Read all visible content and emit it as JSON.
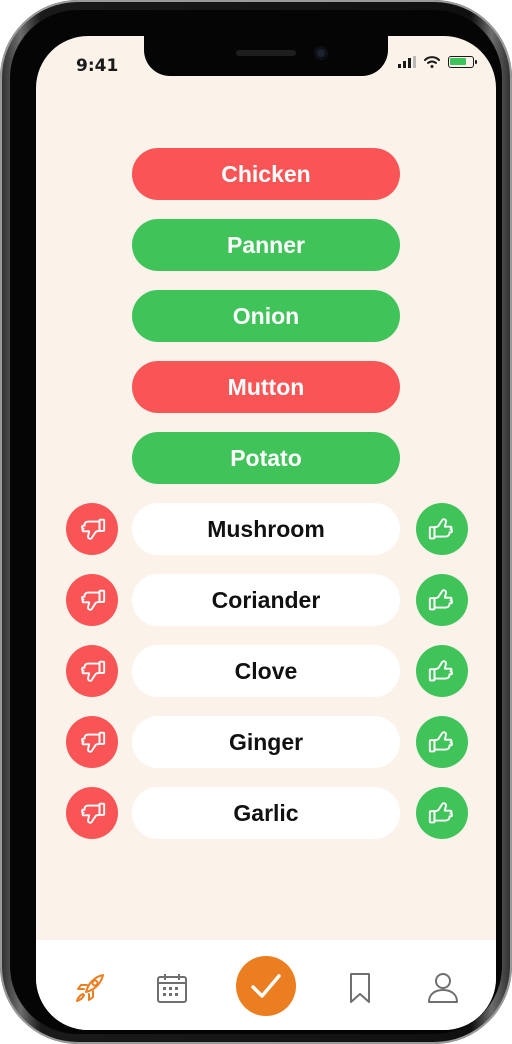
{
  "status_bar": {
    "time": "9:41",
    "battery_level": 0.8
  },
  "selected_ingredients": [
    {
      "label": "Chicken",
      "state": "disliked",
      "color": "#fa5556"
    },
    {
      "label": "Panner",
      "state": "liked",
      "color": "#40c45a"
    },
    {
      "label": "Onion",
      "state": "liked",
      "color": "#40c45a"
    },
    {
      "label": "Mutton",
      "state": "disliked",
      "color": "#fa5556"
    },
    {
      "label": "Potato",
      "state": "liked",
      "color": "#40c45a"
    }
  ],
  "pending_ingredients": [
    {
      "label": "Mushroom"
    },
    {
      "label": "Coriander"
    },
    {
      "label": "Clove"
    },
    {
      "label": "Ginger"
    },
    {
      "label": "Garlic"
    }
  ],
  "actions": {
    "dislike_icon": "thumbs-down-icon",
    "like_icon": "thumbs-up-icon",
    "dislike_color": "#fa5556",
    "like_color": "#40c45a"
  },
  "tab_bar": {
    "items": [
      {
        "icon": "rocket-icon",
        "active": true
      },
      {
        "icon": "calendar-icon",
        "active": false
      },
      {
        "icon": "checkmark-icon",
        "active": false,
        "primary": true
      },
      {
        "icon": "bookmark-icon",
        "active": false
      },
      {
        "icon": "user-icon",
        "active": false
      }
    ],
    "accent_color": "#ec7e22"
  }
}
